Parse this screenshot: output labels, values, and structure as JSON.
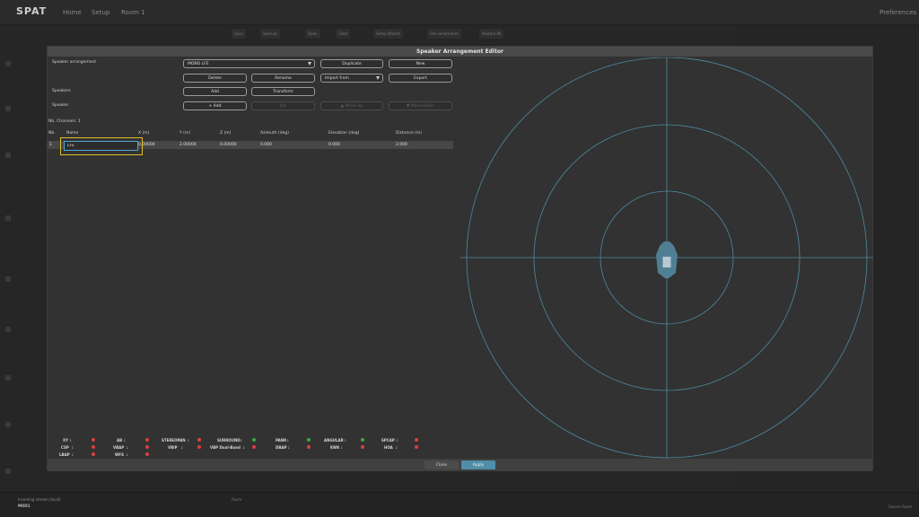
{
  "app": {
    "logo": "SPAT",
    "nav": [
      "Home",
      "Setup",
      "Room 1"
    ],
    "preferences": "Preferences",
    "toolbar": [
      "Save",
      "Save as",
      "Open",
      "Clear",
      "Setup Wizard",
      "Use send/return",
      "Restore All"
    ],
    "bottom_left": "Incoming stream (local)",
    "bottom_left_value": "MOD1",
    "bottom_mid": "Room",
    "bottom_right": "Source Room"
  },
  "modal": {
    "title": "Speaker Arrangement Editor",
    "labels": {
      "speaker_arrangement": "Speaker arrangement",
      "speakers": "Speakers",
      "speaker": "Speaker",
      "nb_channels": "Nb. Channels: 1"
    },
    "arrangement_select": "MONO LFE",
    "import_select": "Import from",
    "buttons": {
      "duplicate": "Duplicate",
      "new": "New",
      "delete": "Delete",
      "rename": "Rename",
      "export": "Export",
      "add": "Add",
      "transform": "Transform",
      "add_speaker": "+ Add",
      "del": "Del",
      "move_up": "▲ Move Up",
      "move_down": "▼ Move Down"
    },
    "table": {
      "headers": [
        "Nb.",
        "Name",
        "X (m)",
        "Y (m)",
        "Z (m)",
        "Azimuth (deg)",
        "Elevation (deg)",
        "Distance (m)"
      ],
      "rows": [
        {
          "nb": "1",
          "name": "LFE",
          "x": "0.00000",
          "y": "2.00000",
          "z": "0.00000",
          "azimuth": "0.000",
          "elevation": "0.000",
          "distance": "2.000"
        }
      ]
    },
    "status": [
      {
        "label": "XY",
        "state": "red"
      },
      {
        "label": "AB",
        "state": "red"
      },
      {
        "label": "STEREOPAN",
        "state": "red"
      },
      {
        "label": "SURROUND",
        "state": "green"
      },
      {
        "label": "PANR",
        "state": "green"
      },
      {
        "label": "ANGULAR",
        "state": "green"
      },
      {
        "label": "SPCAP",
        "state": "red"
      },
      {
        "label": "CSP",
        "state": "red"
      },
      {
        "label": "VBAP",
        "state": "red"
      },
      {
        "label": "VBIP",
        "state": "red"
      },
      {
        "label": "VBP Dual-Band",
        "state": "red"
      },
      {
        "label": "DBAP",
        "state": "red"
      },
      {
        "label": "KNN",
        "state": "red"
      },
      {
        "label": "HOA",
        "state": "red"
      },
      {
        "label": "LBAP",
        "state": "red"
      },
      {
        "label": "WFS",
        "state": "red"
      }
    ],
    "footer": {
      "close": "Close",
      "apply": "Apply"
    }
  },
  "colors": {
    "red": "#d94141",
    "green": "#39a845",
    "accent": "#4f8ea8",
    "highlight": "#e2bf2b"
  }
}
